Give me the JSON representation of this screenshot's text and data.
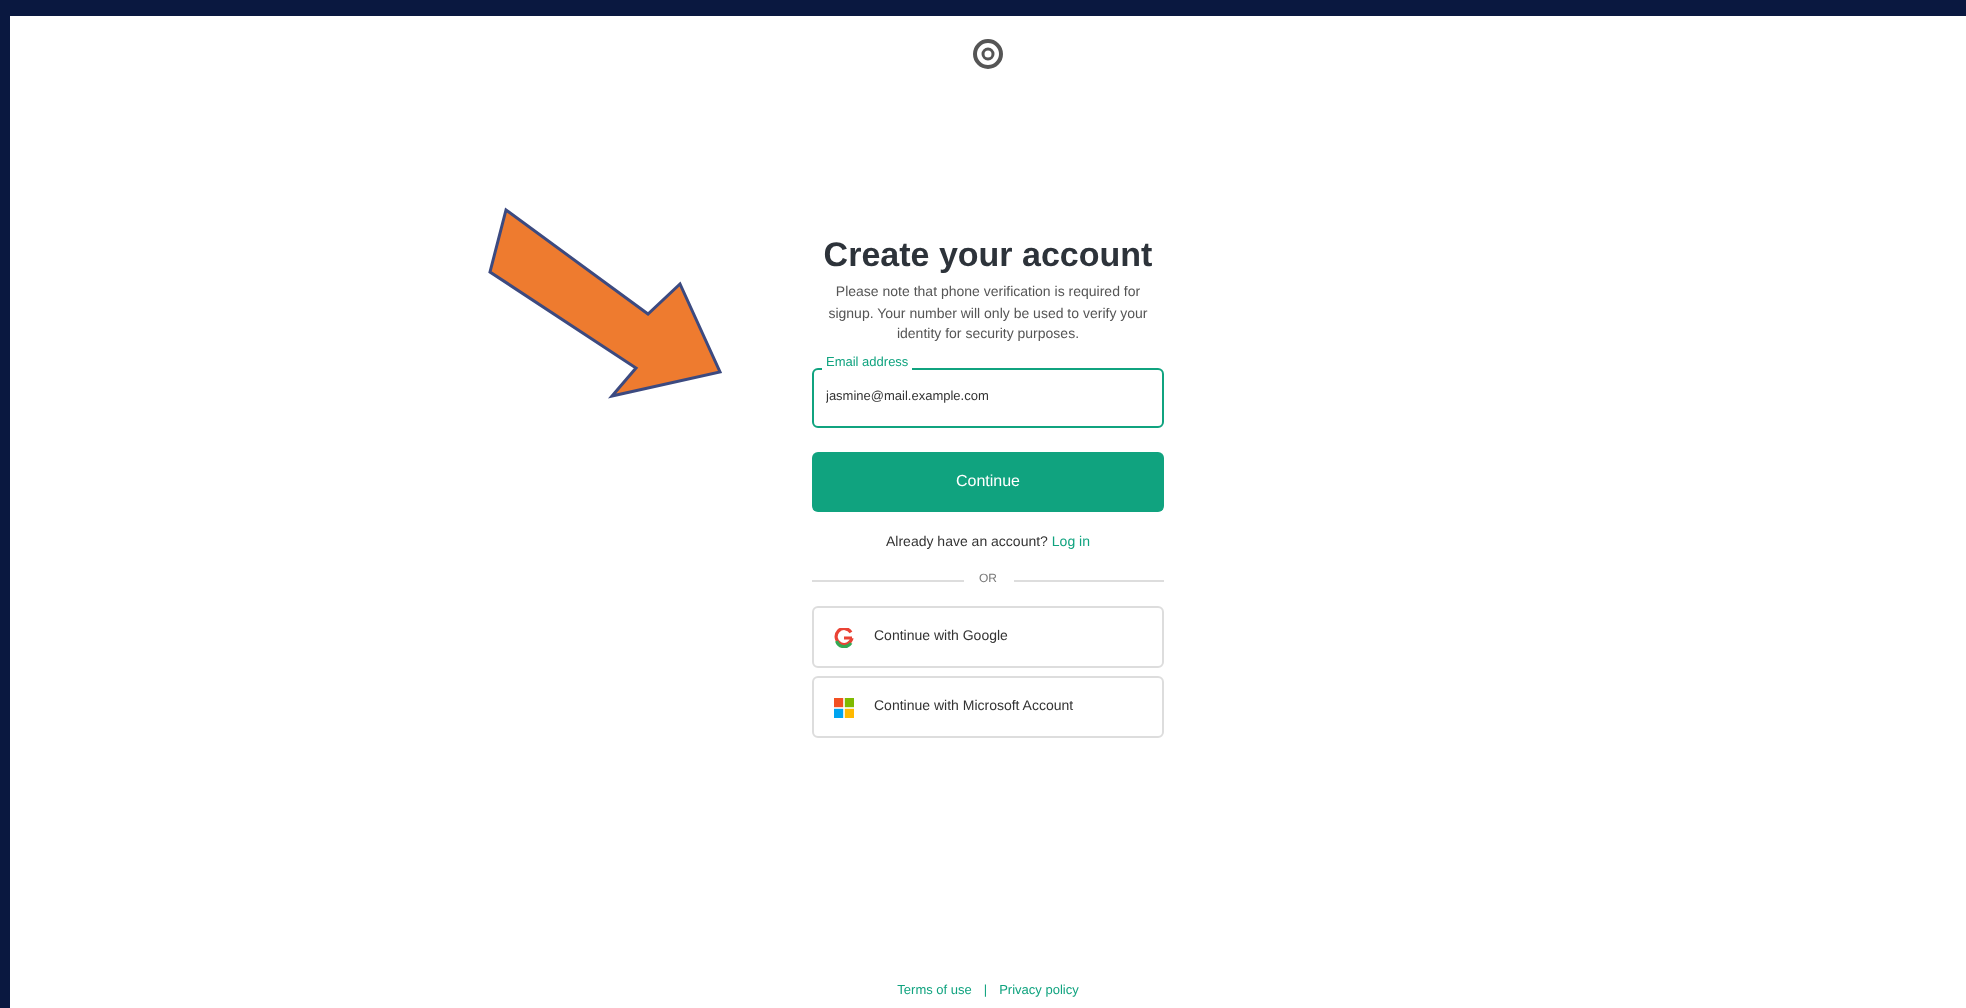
{
  "title": "Create your account",
  "notice": "Please note that phone verification is required for signup. Your number will only be used to verify your identity for security purposes.",
  "email": {
    "label": "Email address",
    "value": "jasmine@mail.example.com"
  },
  "continue_button": "Continue",
  "login_prompt": {
    "text": "Already have an account?",
    "link": "Log in"
  },
  "divider": "OR",
  "social_buttons": [
    {
      "kind": "google",
      "label": "Continue with Google"
    },
    {
      "kind": "microsoft",
      "label": "Continue with Microsoft Account"
    }
  ],
  "footer": {
    "links": [
      "Terms of use",
      "Privacy policy"
    ],
    "separator": "|"
  }
}
